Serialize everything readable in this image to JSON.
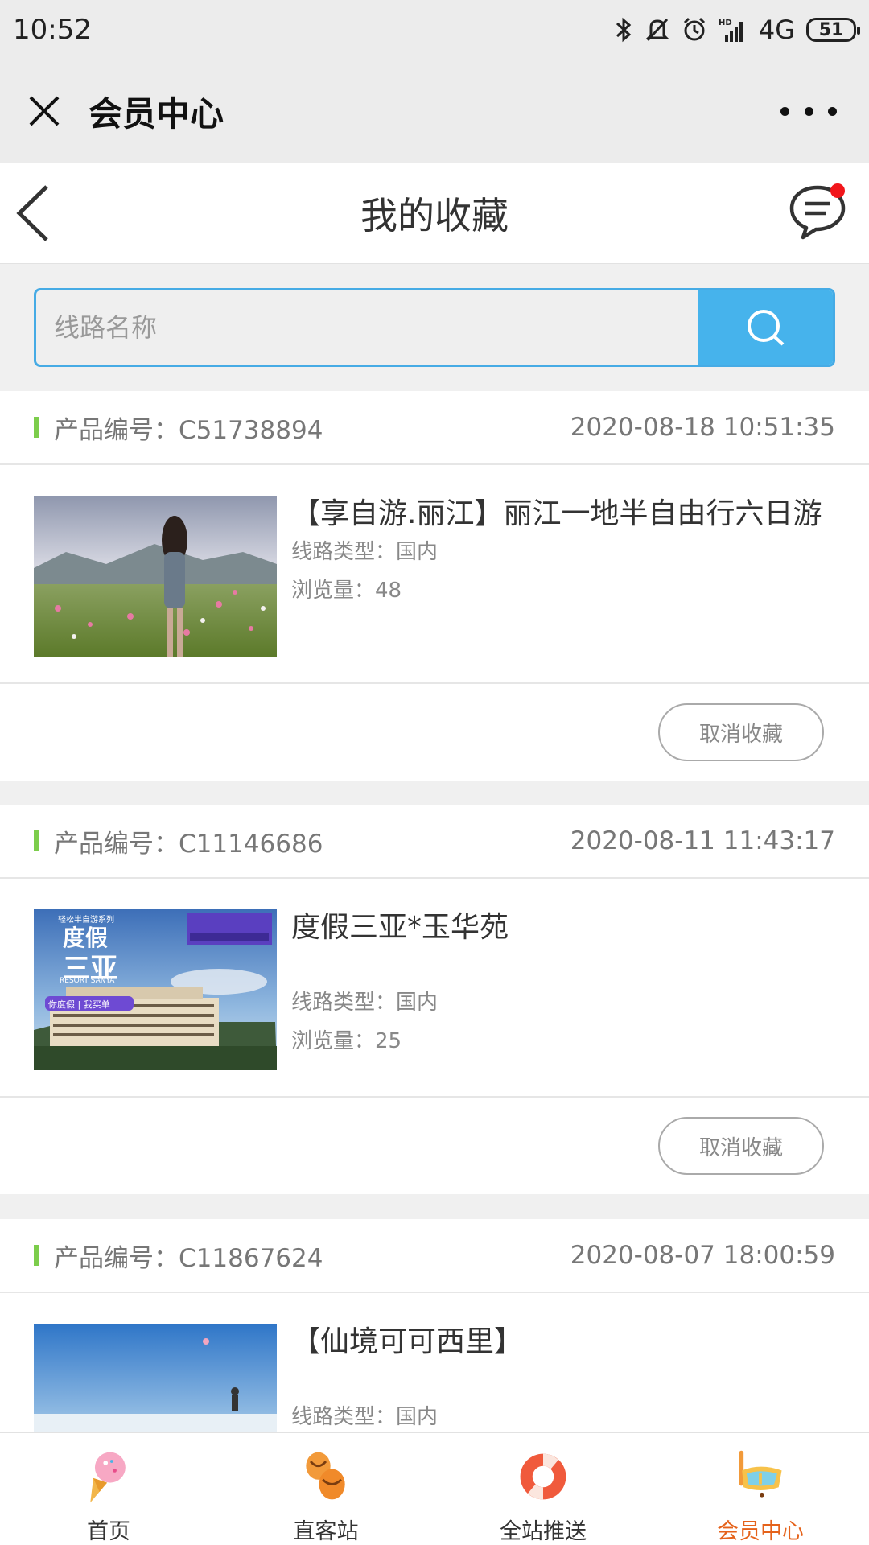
{
  "status_bar": {
    "time": "10:52",
    "network": "4G",
    "battery": "51"
  },
  "wechat_bar": {
    "title": "会员中心"
  },
  "page_header": {
    "title": "我的收藏"
  },
  "search": {
    "placeholder": "线路名称"
  },
  "favorites": [
    {
      "code": "产品编号：C51738894",
      "date": "2020-08-18 10:51:35",
      "name": "【享自游.丽江】丽江一地半自由行六日游",
      "type": "线路类型：国内",
      "views": "浏览量：48",
      "cancel": "取消收藏"
    },
    {
      "code": "产品编号：C11146686",
      "date": "2020-08-11 11:43:17",
      "name": "度假三亚*玉华苑",
      "type": "线路类型：国内",
      "views": "浏览量：25",
      "cancel": "取消收藏",
      "thumb_text": {
        "series": "轻松半自游系列",
        "big1": "度假",
        "big2": "三亚",
        "resort": "RESORT SANYA",
        "badge": "你度假 | 我买单"
      }
    },
    {
      "code": "产品编号：C11867624",
      "date": "2020-08-07 18:00:59",
      "name": "【仙境可可西里】",
      "type": "线路类型：国内"
    }
  ],
  "tabbar": {
    "items": [
      {
        "label": "首页",
        "icon": "ice-cream-icon"
      },
      {
        "label": "直客站",
        "icon": "slippers-icon"
      },
      {
        "label": "全站推送",
        "icon": "lifebuoy-icon"
      },
      {
        "label": "会员中心",
        "icon": "snorkel-mask-icon"
      }
    ],
    "active_color": "#e5621a"
  }
}
